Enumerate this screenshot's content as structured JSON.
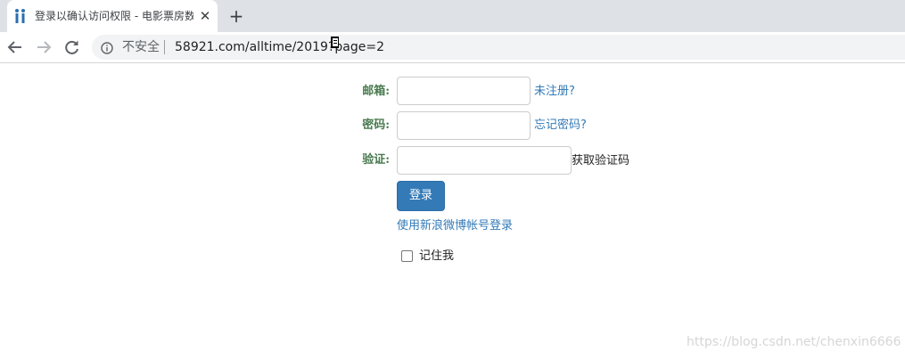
{
  "browser": {
    "tab_title": "登录以确认访问权限 - 电影票房数据",
    "security_label": "不安全",
    "url": "58921.com/alltime/2019?page=2",
    "icons": {
      "favicon": "site-favicon",
      "close": "close-icon",
      "new_tab": "plus-icon",
      "back": "arrow-left-icon",
      "forward": "arrow-right-icon",
      "reload": "reload-icon",
      "info": "info-icon"
    }
  },
  "form": {
    "email_label": "邮箱:",
    "email_value": "",
    "register_link": "未注册?",
    "password_label": "密码:",
    "password_value": "",
    "forgot_link": "忘记密码?",
    "captcha_label": "验证:",
    "captcha_value": "",
    "get_code_text": "获取验证码",
    "login_button": "登录",
    "weibo_link": "使用新浪微博帐号登录",
    "remember_label": "记住我",
    "remember_checked": false
  },
  "watermark": "https://blog.csdn.net/chenxin6666",
  "colors": {
    "label_green": "#497a4f",
    "link_blue": "#337ab7",
    "button_blue": "#337ab7",
    "tabstrip_gray": "#dee1e6"
  }
}
